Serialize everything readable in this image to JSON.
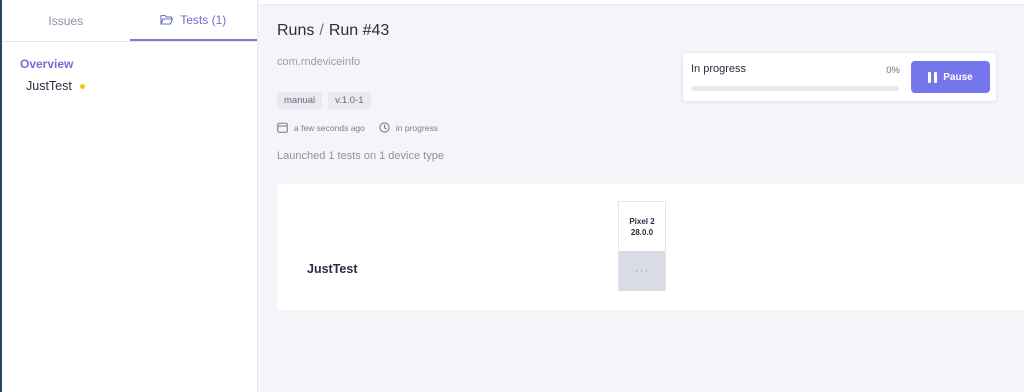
{
  "sidebar": {
    "tabs": [
      {
        "label": "Issues",
        "active": false
      },
      {
        "label": "Tests (1)",
        "active": true,
        "icon": "folder-open-icon"
      }
    ],
    "overview_label": "Overview",
    "items": [
      {
        "label": "JustTest",
        "status_color": "#f5c518"
      }
    ]
  },
  "header": {
    "breadcrumb_root": "Runs",
    "breadcrumb_separator": "/",
    "breadcrumb_current": "Run #43"
  },
  "run": {
    "package": "com.rndeviceinfo",
    "tags": [
      "manual",
      "v.1.0-1"
    ],
    "created": "a few seconds ago",
    "status": "in progress",
    "launched_text": "Launched 1 tests on 1 device type"
  },
  "progress": {
    "status_label": "In progress",
    "percent_label": "0%",
    "percent_value": 0,
    "pause_label": "Pause"
  },
  "results": {
    "test_name": "JustTest",
    "device": {
      "name": "Pixel 2",
      "version": "28.0.0"
    },
    "cell_value": "···"
  },
  "colors": {
    "accent": "#7576ec",
    "sidebar_accent": "#6f70d6",
    "pending_dot": "#f5c518"
  }
}
